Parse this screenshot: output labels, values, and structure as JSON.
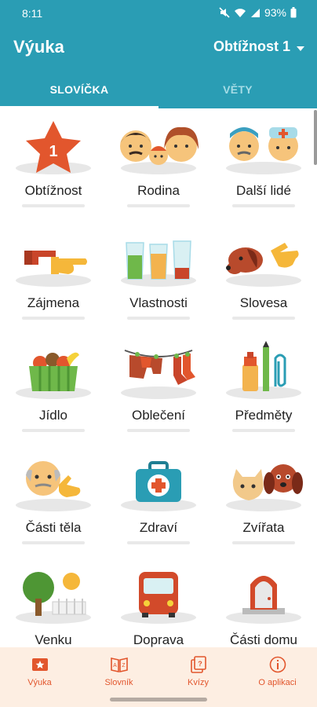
{
  "status_bar": {
    "time": "8:11",
    "battery": "93%"
  },
  "app_bar": {
    "title": "Výuka",
    "difficulty": "Obtížnost 1"
  },
  "tabs": [
    {
      "label": "SLOVÍČKA",
      "active": true
    },
    {
      "label": "VĚTY",
      "active": false
    }
  ],
  "categories": [
    {
      "label": "Obtížnost",
      "icon": "star-badge-icon",
      "badge": "1"
    },
    {
      "label": "Rodina",
      "icon": "family-icon"
    },
    {
      "label": "Další lidé",
      "icon": "people-icon"
    },
    {
      "label": "Zájmena",
      "icon": "pointing-hands-icon"
    },
    {
      "label": "Vlastnosti",
      "icon": "glasses-icon"
    },
    {
      "label": "Slovesa",
      "icon": "dog-hand-icon"
    },
    {
      "label": "Jídlo",
      "icon": "food-basket-icon"
    },
    {
      "label": "Oblečení",
      "icon": "clothesline-icon"
    },
    {
      "label": "Předměty",
      "icon": "objects-icon"
    },
    {
      "label": "Části těla",
      "icon": "body-parts-icon"
    },
    {
      "label": "Zdraví",
      "icon": "first-aid-kit-icon"
    },
    {
      "label": "Zvířata",
      "icon": "animals-icon"
    },
    {
      "label": "Venku",
      "icon": "tree-sun-icon"
    },
    {
      "label": "Doprava",
      "icon": "bus-icon"
    },
    {
      "label": "Části domu",
      "icon": "door-icon"
    }
  ],
  "bottom_nav": [
    {
      "label": "Výuka",
      "icon": "lesson-icon",
      "active": true
    },
    {
      "label": "Slovník",
      "icon": "dictionary-icon",
      "active": false
    },
    {
      "label": "Kvízy",
      "icon": "quiz-icon",
      "active": false
    },
    {
      "label": "O aplikaci",
      "icon": "info-icon",
      "active": false
    }
  ],
  "colors": {
    "primary": "#2a9db4",
    "accent": "#e2562d",
    "nav_background": "#fdeee2"
  }
}
